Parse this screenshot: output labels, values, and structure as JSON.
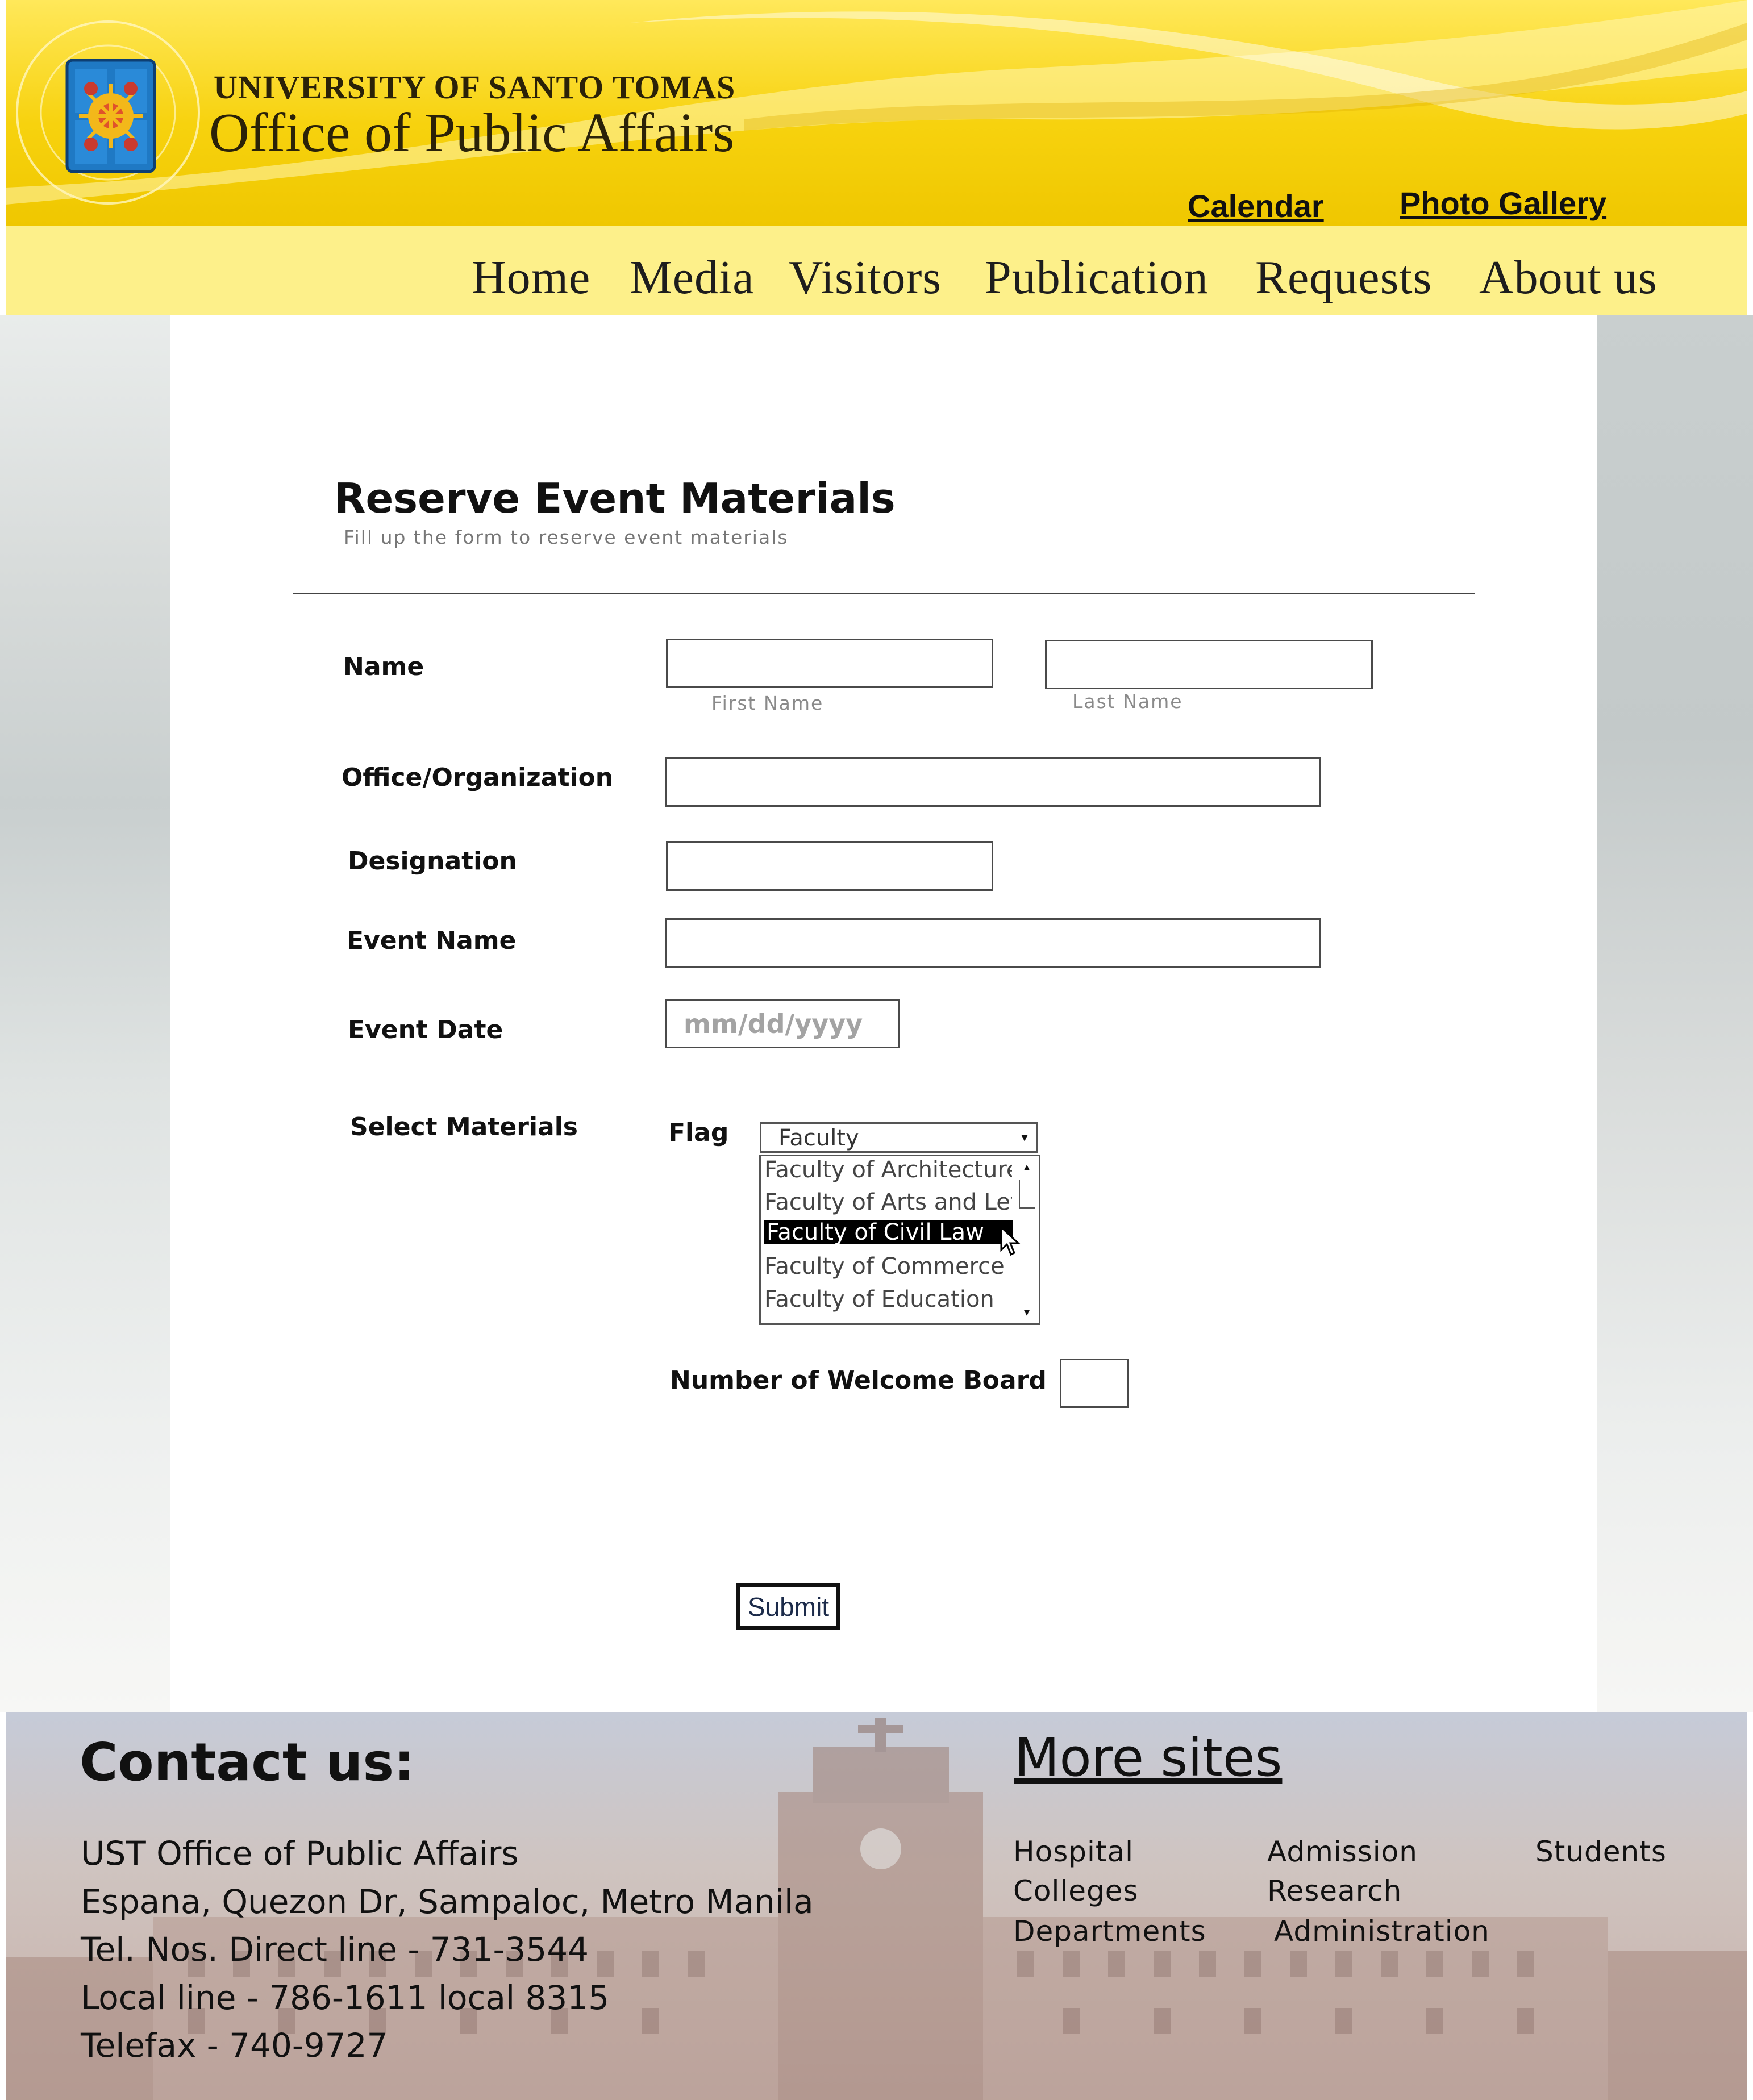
{
  "header": {
    "brand_line1": "UNIVERSITY OF SANTO TOMAS",
    "brand_line2": "Office of Public Affairs",
    "top_links": [
      "Calendar",
      "Photo Gallery"
    ],
    "nav": [
      "Home",
      "Media",
      "Visitors",
      "Publication",
      "Requests",
      "About us"
    ],
    "colors": {
      "banner": "#f7d20e",
      "nav_bar": "#fdf08a"
    }
  },
  "form": {
    "title": "Reserve Event Materials",
    "subtitle": "Fill up the form to reserve event materials",
    "name_label": "Name",
    "first_name_hint": "First Name",
    "last_name_hint": "Last Name",
    "office_label": "Office/Organization",
    "designation_label": "Designation",
    "event_name_label": "Event Name",
    "event_date_label": "Event Date",
    "event_date_placeholder": "mm/dd/yyyy",
    "materials_label": "Select Materials",
    "flag_label": "Flag",
    "flag_selected": "Faculty",
    "flag_options": [
      "Faculty of Architecture",
      "Faculty of Arts and Letters",
      "Faculty of Civil Law",
      "Faculty of Commerce",
      "Faculty of Education"
    ],
    "flag_highlighted": "Faculty of Civil Law",
    "welcome_board_label": "Number of Welcome Board",
    "submit_label": "Submit"
  },
  "footer": {
    "contact_title": "Contact us:",
    "contact_lines": [
      "UST Office of Public Affairs",
      "Espana, Quezon Dr, Sampaloc, Metro Manila",
      "Tel. Nos. Direct line - 731-3544",
      "Local line - 786-1611 local 8315",
      "Telefax - 740-9727"
    ],
    "more_title": "More sites",
    "more_links": {
      "col1": [
        "Hospital",
        "Colleges",
        "Departments"
      ],
      "col2": [
        "Admission",
        "Research",
        "Administration"
      ],
      "col3": [
        "Students"
      ]
    }
  }
}
